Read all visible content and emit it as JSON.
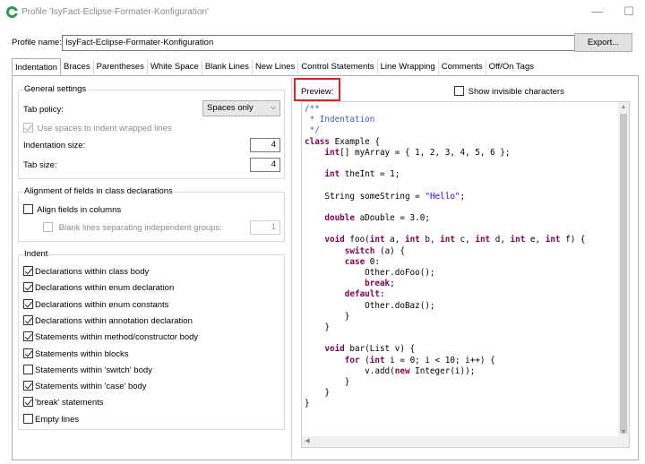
{
  "window": {
    "title": "Profile 'IsyFact-Eclipse-Formater-Konfiguration'",
    "minimize": "—",
    "maximize": "☐"
  },
  "profile": {
    "label": "Profile name:",
    "value": "IsyFact-Eclipse-Formater-Konfiguration",
    "export_label": "Export..."
  },
  "tabs": [
    {
      "label": "Indentation"
    },
    {
      "label": "Braces"
    },
    {
      "label": "Parentheses"
    },
    {
      "label": "White Space"
    },
    {
      "label": "Blank Lines"
    },
    {
      "label": "New Lines"
    },
    {
      "label": "Control Statements"
    },
    {
      "label": "Line Wrapping"
    },
    {
      "label": "Comments"
    },
    {
      "label": "Off/On Tags"
    }
  ],
  "general": {
    "title": "General settings",
    "tab_policy_label": "Tab policy:",
    "tab_policy_value": "Spaces only",
    "use_spaces_label": "Use spaces to indent wrapped lines",
    "indentation_size_label": "Indentation size:",
    "indentation_size_value": "4",
    "tab_size_label": "Tab size:",
    "tab_size_value": "4"
  },
  "alignment": {
    "title": "Alignment of fields in class declarations",
    "align_label": "Align fields in columns",
    "blank_lines_label": "Blank lines separating independent groups:",
    "blank_lines_value": "1"
  },
  "indent": {
    "title": "Indent",
    "items": [
      {
        "label": "Declarations within class body",
        "checked": true
      },
      {
        "label": "Declarations within enum declaration",
        "checked": true
      },
      {
        "label": "Declarations within enum constants",
        "checked": true
      },
      {
        "label": "Declarations within annotation declaration",
        "checked": true
      },
      {
        "label": "Statements within method/constructor body",
        "checked": true
      },
      {
        "label": "Statements within blocks",
        "checked": true
      },
      {
        "label": "Statements within 'switch' body",
        "checked": false
      },
      {
        "label": "Statements within 'case' body",
        "checked": true
      },
      {
        "label": "'break' statements",
        "checked": true
      },
      {
        "label": "Empty lines",
        "checked": false
      }
    ]
  },
  "preview": {
    "label": "Preview:",
    "show_invisible_label": "Show invisible characters",
    "code_lines": [
      "/**",
      " * Indentation",
      " */",
      "class Example {",
      "    int[] myArray = { 1, 2, 3, 4, 5, 6 };",
      "",
      "    int theInt = 1;",
      "",
      "    String someString = \"Hello\";",
      "",
      "    double aDouble = 3.0;",
      "",
      "    void foo(int a, int b, int c, int d, int e, int f) {",
      "        switch (a) {",
      "        case 0:",
      "            Other.doFoo();",
      "            break;",
      "        default:",
      "            Other.doBaz();",
      "        }",
      "    }",
      "",
      "    void bar(List v) {",
      "        for (int i = 0; i < 10; i++) {",
      "            v.add(new Integer(i));",
      "        }",
      "    }",
      "}"
    ]
  }
}
